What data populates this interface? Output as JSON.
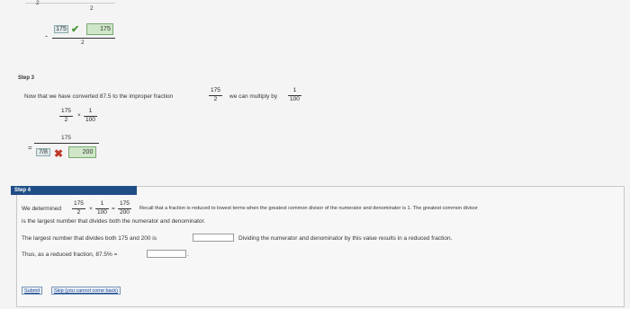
{
  "top": {
    "partial_left": "2",
    "partial_den": "2",
    "minus_sign": "-",
    "answer_entered": "175",
    "answer_correct": "175",
    "den": "2"
  },
  "step3": {
    "label": "Step 3",
    "text_before": "Now that we have converted 87.5 to the improper fraction",
    "frac_num": "175",
    "frac_den": "2",
    "text_after": "we can multiply by",
    "mult_num": "1",
    "mult_den": "100",
    "expr_left_num": "175",
    "expr_left_den": "2",
    "times": "×",
    "expr_right_num": "1",
    "expr_right_den": "100",
    "equals": "=",
    "result_num": "175",
    "result_den_entered": "7/8",
    "result_den_correct": "200"
  },
  "step4": {
    "label": "Step 4",
    "line1_prefix": "We determined",
    "f1_num": "175",
    "f1_den": "2",
    "times": "×",
    "f2_num": "1",
    "f2_den": "100",
    "equals": "=",
    "f3_num": "175",
    "f3_den": "200",
    "line1_suffix": "Recall that a fraction is reduced to lowest terms when the greatest common divisor of the numerator and denominator is 1. The greatest common divisor",
    "line2": "is the largest number that divides both the numerator and denominator.",
    "q1_prefix": "The largest number that divides both 175 and 200 is",
    "q1_suffix": "Dividing the numerator and denominator by this value results in a reduced fraction.",
    "q2_prefix": "Thus, as a reduced fraction, 87.5% =",
    "q2_suffix": ".",
    "submit_label": "Submit",
    "skip_label": "Skip (you cannot come back)"
  }
}
